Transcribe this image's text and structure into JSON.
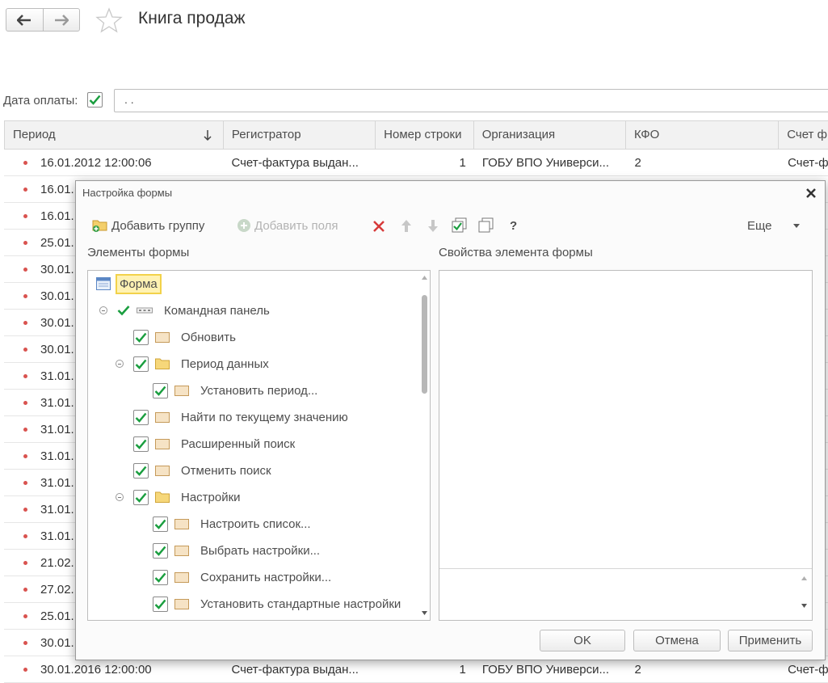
{
  "app": {
    "title": "Книга продаж"
  },
  "filter": {
    "label": "Дата оплаты:",
    "checked": true,
    "value": ". ."
  },
  "table": {
    "columns": [
      "Период",
      "Регистратор",
      "Номер строки",
      "Организация",
      "КФО",
      "Счет ф"
    ],
    "first_row": [
      "16.01.2012 12:00:06",
      "Счет-фактура выдан...",
      "1",
      "ГОБУ ВПО Универси...",
      "2",
      "Счет-ф"
    ],
    "row_periods": [
      "16.01.",
      "16.01.",
      "25.01.",
      "30.01.",
      "30.01.",
      "30.01.",
      "30.01.",
      "31.01.",
      "31.01.",
      "31.01.",
      "31.01.",
      "31.01.",
      "31.01.",
      "31.01.",
      "21.02.",
      "27.02.",
      "25.01.",
      "30.01."
    ],
    "last_row": [
      "30.01.2016 12:00:00",
      "Счет-фактура выдан...",
      "1",
      "ГОБУ ВПО Универси...",
      "2",
      "Счет-ф"
    ]
  },
  "dialog": {
    "title": "Настройка формы",
    "toolbar": {
      "add_group": "Добавить группу",
      "add_fields": "Добавить поля",
      "help": "?",
      "more": "Еще"
    },
    "left_header": "Элементы формы",
    "right_header": "Свойства элемента формы",
    "tree": [
      {
        "label": "Форма"
      },
      {
        "label": "Командная панель"
      },
      {
        "label": "Обновить"
      },
      {
        "label": "Период данных"
      },
      {
        "label": "Установить период..."
      },
      {
        "label": "Найти по текущему значению"
      },
      {
        "label": "Расширенный поиск"
      },
      {
        "label": "Отменить поиск"
      },
      {
        "label": "Настройки"
      },
      {
        "label": "Настроить список..."
      },
      {
        "label": "Выбрать настройки..."
      },
      {
        "label": "Сохранить настройки..."
      },
      {
        "label": "Установить стандартные настройки"
      }
    ],
    "buttons": {
      "ok": "OK",
      "cancel": "Отмена",
      "apply": "Применить"
    }
  },
  "colors": {
    "check": "#1a9e3f",
    "dot": "#d9534f",
    "highlight": "#fff2b3"
  }
}
